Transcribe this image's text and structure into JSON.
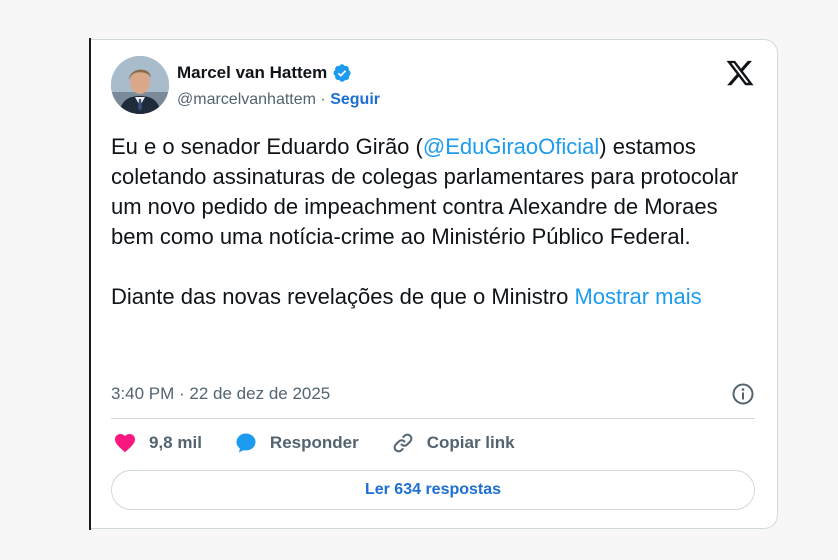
{
  "author": {
    "name": "Marcel van Hattem",
    "handle": "@marcelvanhattem",
    "separator": "·",
    "follow_label": "Seguir"
  },
  "tweet": {
    "para1_before": "Eu e o senador Eduardo Girão (",
    "para1_mention": "@EduGiraoOficial",
    "para1_after": ") estamos coletando assinaturas de colegas parlamentares para protocolar um novo pedido de impeachment contra Alexandre de Moraes bem como uma notícia-crime ao Ministério Público Federal.",
    "para2_before": "Diante das novas revelações de que o Ministro ",
    "para2_more": "Mostrar mais"
  },
  "meta": {
    "timestamp": "3:40 PM · 22 de dez de 2025"
  },
  "actions": {
    "like_count": "9,8 mil",
    "reply_label": "Responder",
    "copy_label": "Copiar link"
  },
  "replies_button": "Ler 634 respostas",
  "colors": {
    "accent": "#1d9bf0",
    "link_dark": "#1d6fd1",
    "heart": "#f91880",
    "text": "#0f1419",
    "muted": "#536471"
  },
  "icons": [
    "verified-badge-icon",
    "x-logo-icon",
    "info-icon",
    "heart-icon",
    "reply-bubble-icon",
    "link-icon"
  ]
}
